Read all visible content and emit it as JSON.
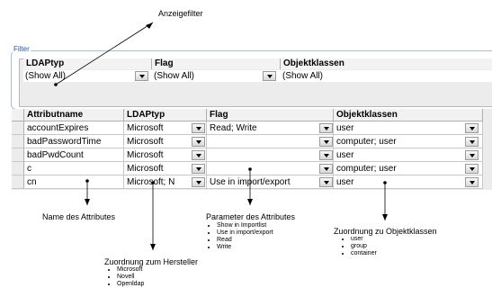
{
  "annotations": {
    "anzeigefilter": "Anzeigefilter",
    "name_attribute": "Name des Attributes",
    "parameter_title": "Parameter des Attributes",
    "parameter_items": [
      "Show in Importlist",
      "Use in import/export",
      "Read",
      "Write"
    ],
    "hersteller_title": "Zuordnung zum Hersteller",
    "hersteller_items": [
      "Microsoft",
      "Novell",
      "Openldap"
    ],
    "objektklassen_title": "Zuordnung zu Objektklassen",
    "objektklassen_items": [
      "user",
      "group",
      "container"
    ]
  },
  "filter": {
    "legend": "Filter",
    "headers": [
      "LDAPtyp",
      "Flag",
      "Objektklassen"
    ],
    "values": [
      "(Show All)",
      "(Show All)",
      "(Show All)"
    ]
  },
  "grid": {
    "headers": [
      "Attributname",
      "LDAPtyp",
      "Flag",
      "Objektklassen"
    ],
    "rows": [
      {
        "name": "accountExpires",
        "ldap": "Microsoft",
        "flag": "Read; Write",
        "klassen": "user"
      },
      {
        "name": "badPasswordTime",
        "ldap": "Microsoft",
        "flag": "",
        "klassen": "computer; user"
      },
      {
        "name": "badPwdCount",
        "ldap": "Microsoft",
        "flag": "",
        "klassen": "user"
      },
      {
        "name": "c",
        "ldap": "Microsoft",
        "flag": "",
        "klassen": "computer; user"
      },
      {
        "name": "cn",
        "ldap": "Microsoft; N",
        "flag": "Use in import/export",
        "klassen": "user"
      }
    ]
  },
  "colors": {
    "filter_legend": "#1c57b7",
    "filter_border": "#a9bfd6"
  }
}
